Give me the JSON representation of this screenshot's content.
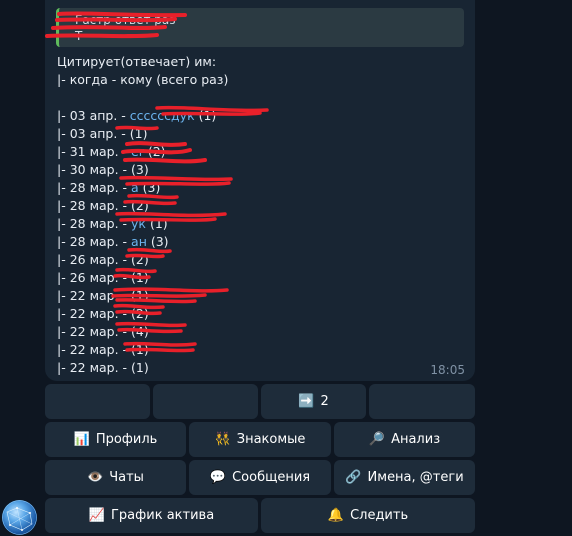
{
  "message": {
    "reply_preview": {
      "line1": "Гастр ответ раз",
      "line2": "Т    "
    },
    "heading": "Цитирует(отвечает) им:",
    "subheading": "|- когда - кому (всего раз)",
    "entries": [
      {
        "prefix": "|- 03 апр. - ",
        "name": "ссссссд",
        "name2": "ук",
        "count": " (1)"
      },
      {
        "prefix": "|- 03 апр. - ",
        "name": "",
        "name2": "",
        "count": " (1)"
      },
      {
        "prefix": "|- 31 мар. - ",
        "name": "",
        "name2": "er",
        "count": " (2)"
      },
      {
        "prefix": "|- 30 мар. - ",
        "name": "",
        "name2": "",
        "count": " (3)"
      },
      {
        "prefix": "|- 28 мар. - ",
        "name": "",
        "name2": "а",
        "count": " (3)"
      },
      {
        "prefix": "|- 28 мар. - ",
        "name": "",
        "name2": "",
        "count": " (2)"
      },
      {
        "prefix": "|- 28 мар. - ",
        "name": "",
        "name2": "ук",
        "count": " (1)"
      },
      {
        "prefix": "|- 28 мар. - ",
        "name": "",
        "name2": "ан",
        "count": " (3)"
      },
      {
        "prefix": "|- 26 мар. - ",
        "name": "",
        "name2": "",
        "count": " (2)"
      },
      {
        "prefix": "|- 26 мар. - ",
        "name": "",
        "name2": "",
        "count": " (1)"
      },
      {
        "prefix": "|- 22 мар. - ",
        "name": "",
        "name2": "",
        "count": " (1)"
      },
      {
        "prefix": "|- 22 мар. - ",
        "name": "",
        "name2": "",
        "count": " (2)"
      },
      {
        "prefix": "|- 22 мар. - ",
        "name": "",
        "name2": "",
        "count": " (4)"
      },
      {
        "prefix": "|- 22 мар. - ",
        "name": "",
        "name2": "",
        "count": " (1)"
      },
      {
        "prefix": "|- 22 мар. - ",
        "name": "",
        "name2": "",
        "count": " (1)"
      }
    ],
    "time": "18:05"
  },
  "keyboard": {
    "pager": {
      "next_label": "2",
      "next_icon": "➡️"
    },
    "buttons": {
      "profile": {
        "icon": "📊",
        "label": "Профиль"
      },
      "acquaintances": {
        "icon": "👯",
        "label": "Знакомые"
      },
      "analysis": {
        "icon": "🔎",
        "label": "Анализ"
      },
      "chats": {
        "icon": "👁️",
        "label": "Чаты"
      },
      "messages": {
        "icon": "💬",
        "label": "Сообщения"
      },
      "names_tags": {
        "icon": "🔗",
        "label": "Имена, @теги"
      },
      "activity_graph": {
        "icon": "📈",
        "label": "График актива"
      },
      "follow": {
        "icon": "🔔",
        "label": "Следить"
      }
    }
  },
  "colors": {
    "background": "#0e1621",
    "bubble": "#182533",
    "button": "#1e2c3a",
    "link": "#6cb4ee",
    "redaction": "#e8202a",
    "reply_bar": "#5fbb5c"
  }
}
